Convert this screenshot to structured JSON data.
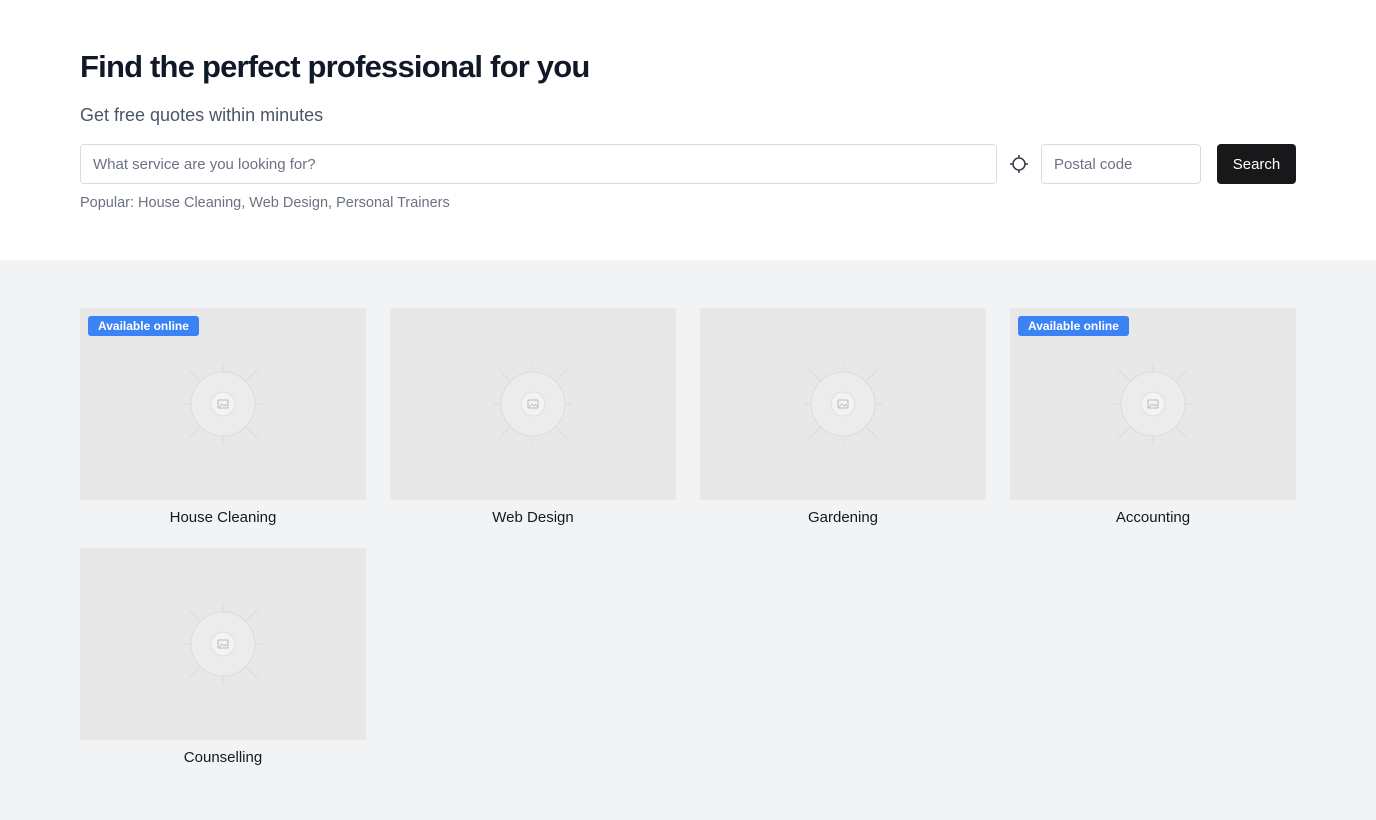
{
  "hero": {
    "title": "Find the perfect professional for you",
    "subtitle": "Get free quotes within minutes"
  },
  "search": {
    "service_placeholder": "What service are you looking for?",
    "locate_icon": "crosshair-icon",
    "postal_placeholder": "Postal code",
    "button_label": "Search"
  },
  "popular": {
    "prefix": "Popular:",
    "items": [
      "House Cleaning",
      "Web Design",
      "Personal Trainers"
    ]
  },
  "services": [
    {
      "title": "House Cleaning",
      "badge": "Available online",
      "icon": "image-placeholder-icon"
    },
    {
      "title": "Web Design",
      "badge": "",
      "icon": "image-placeholder-icon"
    },
    {
      "title": "Gardening",
      "badge": "",
      "icon": "image-placeholder-icon"
    },
    {
      "title": "Accounting",
      "badge": "Available online",
      "icon": "image-placeholder-icon"
    },
    {
      "title": "Counselling",
      "badge": "",
      "icon": "image-placeholder-icon"
    }
  ],
  "colors": {
    "badge": "#3b82f6",
    "search_button": "#18181b",
    "section_bg": "#f2f3f5",
    "placeholder_bg": "#e8e8e8"
  }
}
